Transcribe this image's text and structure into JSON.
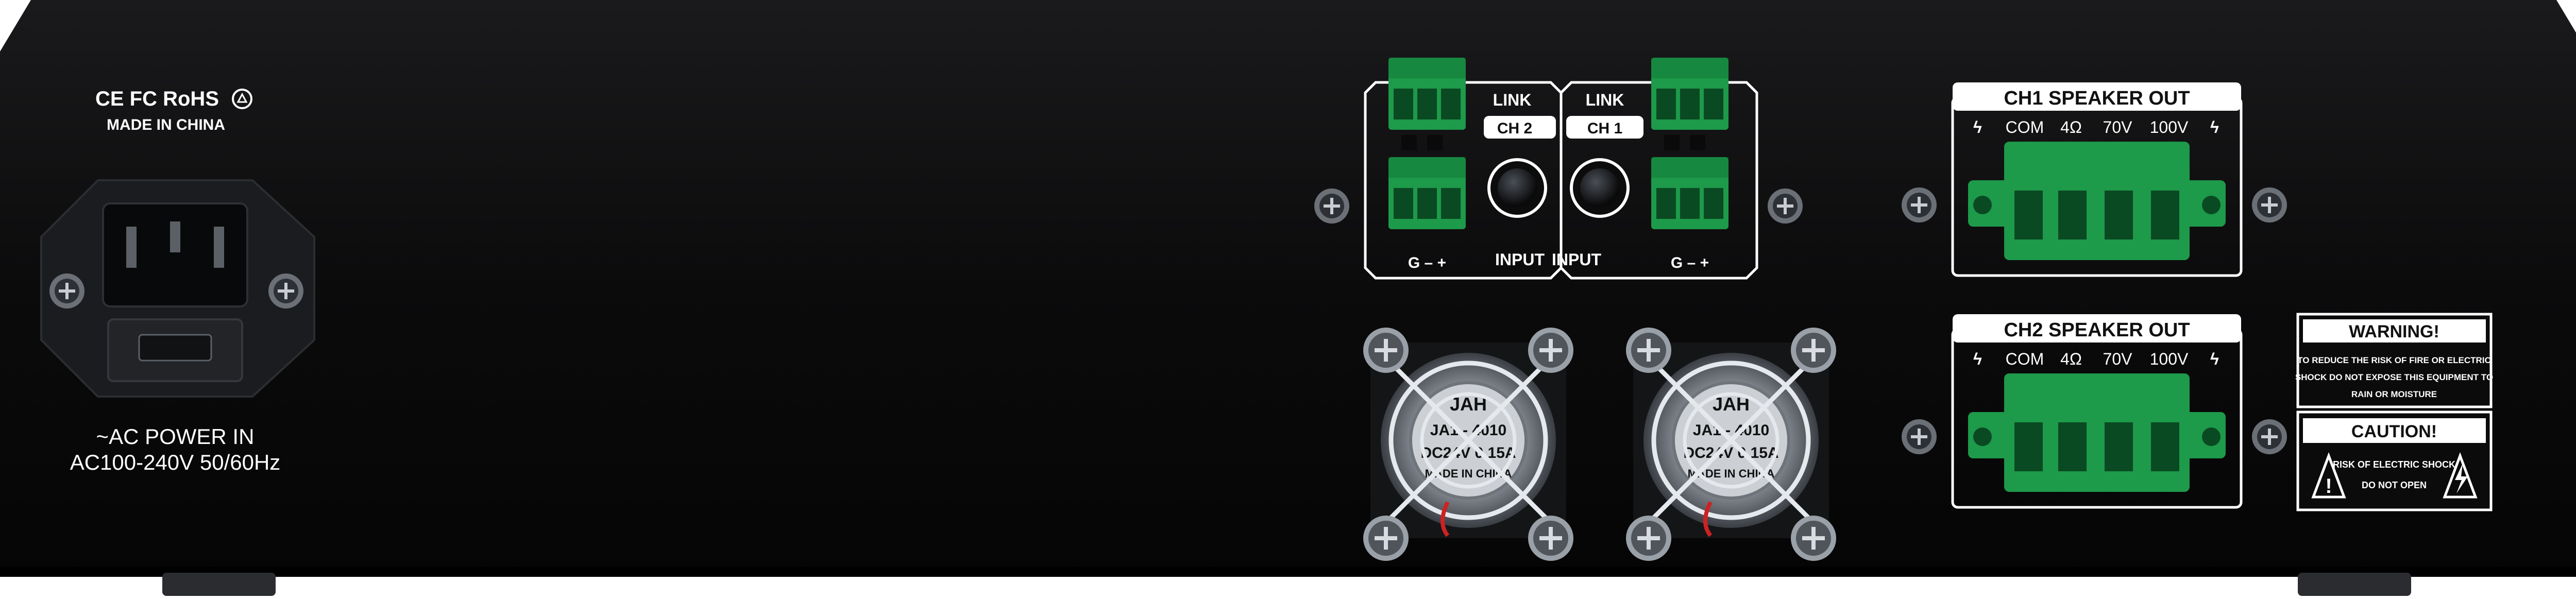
{
  "certifications": {
    "marks": "CE FC RoHS",
    "recycle_symbol": "recycle-icon",
    "made_in": "MADE IN CHINA"
  },
  "power": {
    "label": "~AC POWER IN",
    "rating": "AC100-240V 50/60Hz"
  },
  "input_section": {
    "ch2": {
      "link_label": "LINK",
      "channel_label": "CH 2",
      "terminal_label": "G  –  +",
      "input_label": "INPUT"
    },
    "ch1": {
      "link_label": "LINK",
      "channel_label": "CH 1",
      "terminal_label": "G  –  +",
      "input_label": "INPUT"
    }
  },
  "fans": {
    "fan_label_line1": "JAH",
    "fan_label_line2": "JA1 - 4010",
    "fan_label_line3": "DC24V 0.15A",
    "fan_label_line4": "MADE IN CHINA"
  },
  "speaker_outputs": [
    {
      "title": "CH1 SPEAKER OUT",
      "terminals": [
        "COM",
        "4Ω",
        "70V",
        "100V"
      ]
    },
    {
      "title": "CH2 SPEAKER OUT",
      "terminals": [
        "COM",
        "4Ω",
        "70V",
        "100V"
      ]
    }
  ],
  "warning": {
    "title": "WARNING!",
    "line1": "TO REDUCE THE RISK OF FIRE OR ELECTRIC",
    "line2": "SHOCK DO NOT EXPOSE THIS EQUIPMENT TO",
    "line3": "RAIN OR MOISTURE"
  },
  "caution": {
    "title": "CAUTION!",
    "line1": "RISK OF ELECTRIC SHOCK",
    "line2": "DO NOT OPEN"
  },
  "colors": {
    "chassis": "#0b0b0c",
    "terminal_green": "#1d9a4a",
    "text": "#ffffff"
  }
}
